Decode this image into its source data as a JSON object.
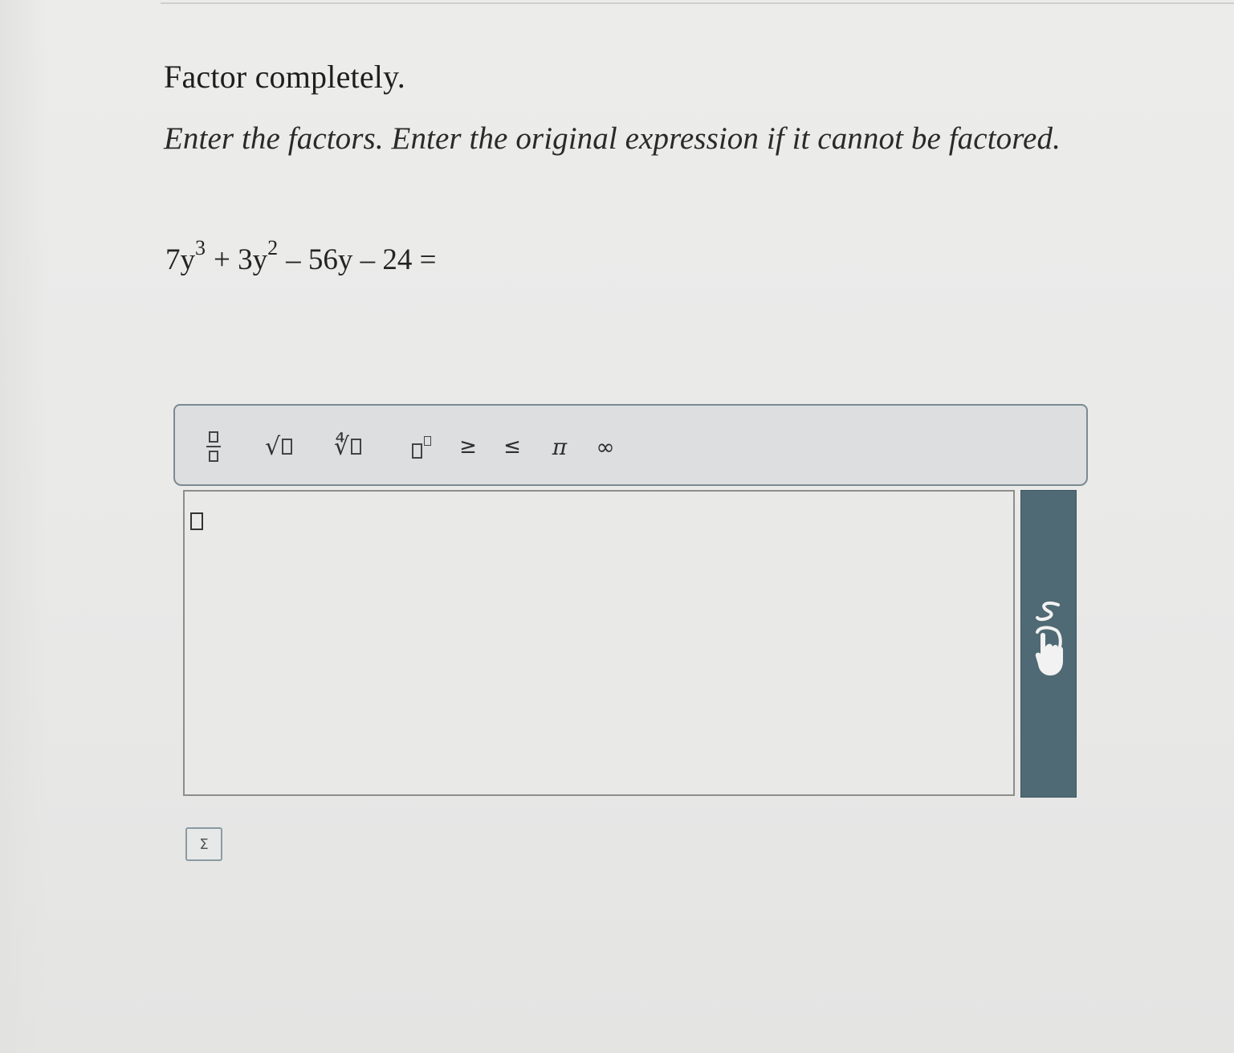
{
  "question": {
    "heading": "Factor completely.",
    "instructions": "Enter the factors. Enter the original expression if it cannot be factored.",
    "expression": {
      "t1_coef": "7y",
      "t1_exp": "3",
      "t2_prefix": "+ 3y",
      "t2_exp": "2",
      "rest": "– 56y – 24 ="
    }
  },
  "toolbar": {
    "tools": [
      {
        "name": "fraction",
        "icon": "fraction-icon"
      },
      {
        "name": "square-root",
        "icon": "sqrt-icon",
        "glyph": "√"
      },
      {
        "name": "nth-root",
        "icon": "nth-root-icon",
        "glyph": "∜"
      },
      {
        "name": "superscript",
        "icon": "superscript-icon"
      },
      {
        "name": "greater-equal",
        "glyph": "≥"
      },
      {
        "name": "less-equal",
        "glyph": "≤"
      },
      {
        "name": "pi",
        "glyph": "π"
      },
      {
        "name": "infinity",
        "glyph": "∞"
      }
    ]
  },
  "answer": {
    "value": ""
  },
  "side_panel": {
    "icon": "hand-pointer-icon",
    "color": "#4f6a74"
  },
  "sigma_button": {
    "label": "Σ"
  }
}
